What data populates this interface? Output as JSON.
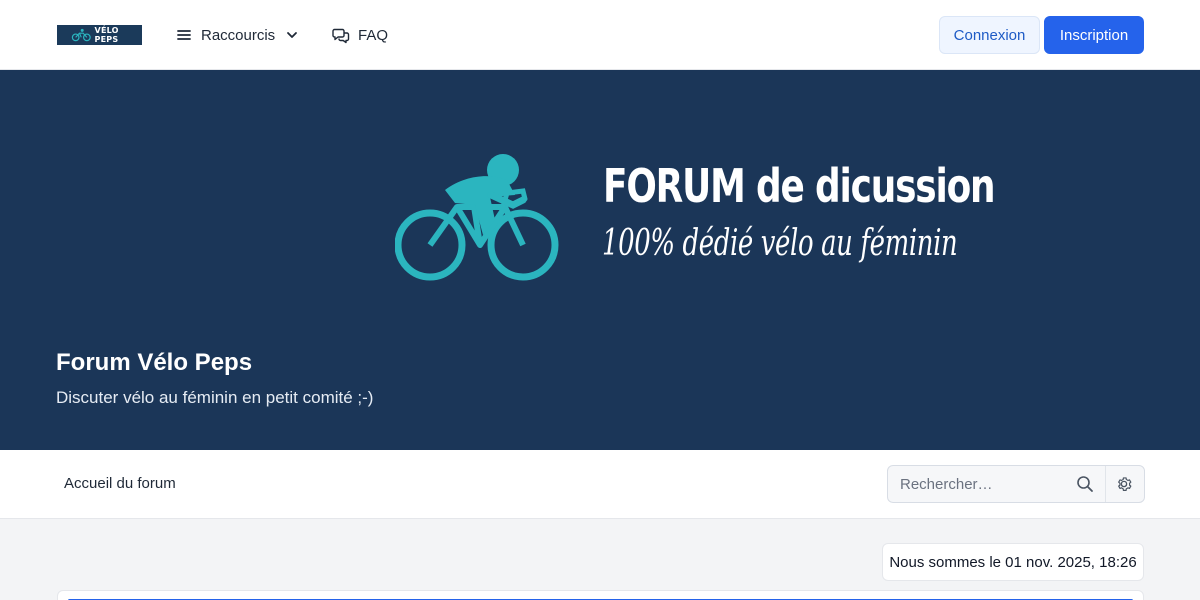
{
  "navbar": {
    "logo_text": "VÉLO PEPS",
    "shortcuts_label": "Raccourcis",
    "faq_label": "FAQ",
    "login_label": "Connexion",
    "register_label": "Inscription"
  },
  "banner": {
    "title": "FORUM de dicussion",
    "subtitle": "100% dédié vélo au féminin"
  },
  "site": {
    "title": "Forum Vélo Peps",
    "description": "Discuter vélo au féminin en petit comité ;-)"
  },
  "breadcrumb": {
    "home_label": "Accueil du forum"
  },
  "search": {
    "placeholder": "Rechercher…"
  },
  "status": {
    "current_date": "Nous sommes le 01 nov. 2025, 18:26"
  },
  "colors": {
    "hero_bg": "#1b3658",
    "accent": "#2563eb",
    "cyclist": "#2bb5bf"
  },
  "icons": {
    "shortcuts": "hamburger-menu-icon",
    "shortcuts_caret": "chevron-down-icon",
    "faq": "chat-bubbles-icon",
    "search": "search-icon",
    "advanced_search": "gear-icon",
    "banner": "cyclist-icon"
  }
}
